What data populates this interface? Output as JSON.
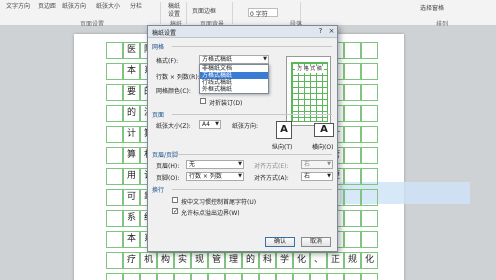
{
  "ribbon": {
    "row1": [
      "文字方向",
      "页边距",
      "纸张方向",
      "纸张大小",
      "分栏"
    ],
    "row1b": [
      "稿纸",
      "设置",
      "页面边框",
      "0 字符",
      "段落"
    ],
    "group_labels": [
      "页面设置",
      "稿纸",
      "页面背景",
      "段落",
      "排列"
    ],
    "arrange_btn": "选择窗格",
    "spinner_value": "0 字符"
  },
  "document": {
    "rows": [
      [
        "",
        "医",
        "院",
        "门",
        "",
        "",
        "",
        "",
        "",
        "",
        "",
        "",
        "",
        "",
        "",
        ""
      ],
      [
        "",
        "本",
        "系",
        "统",
        "",
        "",
        "",
        "",
        "",
        "",
        "",
        "",
        "",
        "",
        "",
        ""
      ],
      [
        "",
        "要",
        "的",
        "意",
        "",
        "",
        "",
        "",
        "",
        "",
        "",
        "",
        "",
        "",
        "",
        ""
      ],
      [
        "",
        "的",
        "流",
        "程",
        "",
        "",
        "",
        "",
        "",
        "",
        "",
        "",
        "",
        "",
        "",
        ""
      ],
      [
        "",
        "计",
        "算",
        "机",
        "",
        "",
        "",
        "",
        "",
        "",
        "",
        "",
        "用",
        "计"
      ],
      [
        "",
        "算",
        "机",
        "识",
        "",
        "",
        "",
        "",
        "",
        "",
        "",
        "",
        "行",
        "管"
      ],
      [
        "",
        "用",
        "计",
        "算",
        "",
        "",
        "",
        "",
        "",
        "",
        "",
        "",
        "方",
        "便"
      ],
      [
        "",
        "可",
        "靠",
        "性",
        "",
        "",
        "",
        "",
        "",
        "",
        "",
        "",
        "",
        ""
      ],
      [
        "",
        "系",
        "统",
        "管",
        "",
        "",
        "",
        "",
        "",
        "",
        "",
        "",
        "",
        ""
      ],
      [
        "",
        "本",
        "系",
        "统",
        "",
        "",
        "",
        "",
        "",
        "",
        "",
        "",
        "",
        ""
      ],
      [
        "",
        "疗",
        "机",
        "构",
        "实",
        "现",
        "管",
        "理",
        "的",
        "科",
        "学",
        "化",
        "、",
        "正",
        "规",
        "化"
      ],
      [
        "",
        "",
        "",
        "",
        "",
        "",
        "",
        "",
        "",
        "",
        "",
        "",
        "",
        "",
        "",
        ""
      ]
    ],
    "tail": "，并且与先"
  },
  "dialog": {
    "title": "稿纸设置",
    "section_grid": "网格",
    "format_label": "格式(F):",
    "format_value": "方格式稿纸",
    "format_options": [
      "非稿纸文档",
      "方格式稿纸",
      "行线式稿纸",
      "外框式稿纸"
    ],
    "format_selected_index": 1,
    "rows_cols_label": "行数 × 列数(R):",
    "grid_color_label": "网格颜色(C):",
    "double_sided_label": "对折装订(D)",
    "preview_text": "方 格 式 稿",
    "section_page": "页面",
    "paper_size_label": "纸张大小(Z):",
    "paper_size_value": "A4",
    "orientation_label": "纸张方向:",
    "portrait_label": "纵向(T)",
    "landscape_label": "横向(O)",
    "section_header": "页眉/页脚",
    "header_label": "页眉(H):",
    "header_value": "无",
    "align_label_1": "对齐方式(E):",
    "align_value_1": "右",
    "footer_label": "页脚(O):",
    "footer_value": "行数 × 列数",
    "align_label_2": "对齐方式(A):",
    "align_value_2": "右",
    "section_wrap": "换行",
    "wrap_opt1": "按中文习惯控制首尾字符(U)",
    "wrap_opt1_checked": false,
    "wrap_opt2": "允许标点溢出边界(W)",
    "wrap_opt2_checked": true,
    "ok_label": "确认",
    "cancel_label": "取消",
    "help_icon": "?",
    "close_icon": "×"
  }
}
